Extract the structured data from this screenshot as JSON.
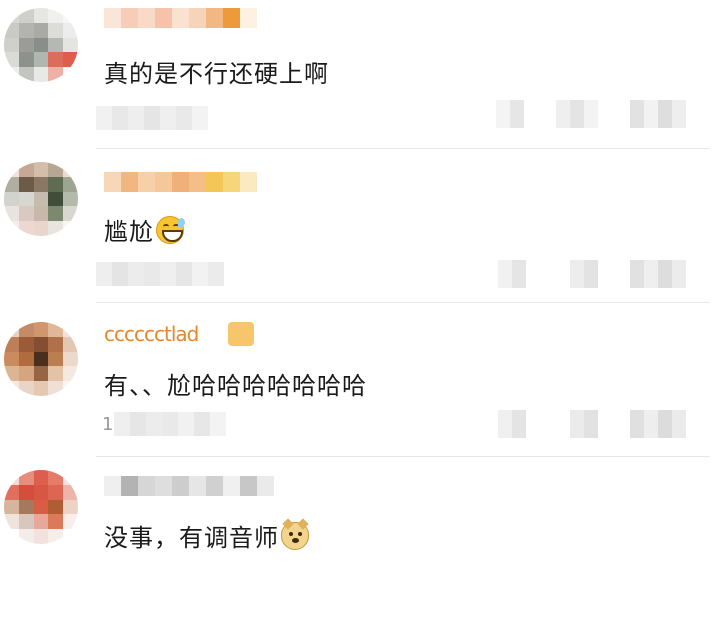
{
  "comments": [
    {
      "text": "真的是不行还硬上啊",
      "emoji": null
    },
    {
      "text": "尴尬",
      "emoji": "grinning-sweat-icon"
    },
    {
      "text": "有、、尬哈哈哈哈哈哈哈",
      "emoji": null,
      "username_partial": "cccccctlad",
      "meta_prefix": "1"
    },
    {
      "text": "没事，有调音师",
      "emoji": "doge-icon"
    }
  ]
}
